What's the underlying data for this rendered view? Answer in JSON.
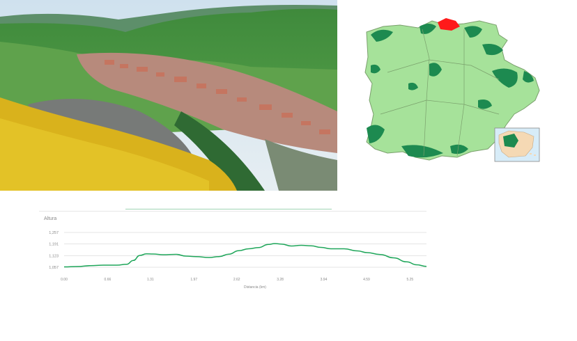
{
  "photo": {
    "subject": "aerial-view-village-valley"
  },
  "region_map": {
    "region_fill": "#a6e29a",
    "forest_fill": "#1d8a50",
    "highlight_fill": "#ff1a1a"
  },
  "chart_data": {
    "type": "area",
    "title": "Altura",
    "xlabel": "Distancia (km)",
    "ylabel": "",
    "x_ticks": [
      "0.00",
      "0.66",
      "1.31",
      "1.97",
      "2.62",
      "3.28",
      "3.94",
      "4.59",
      "5.25"
    ],
    "y_ticks": [
      "1,057",
      "1,123",
      "1,191",
      "1,257"
    ],
    "xlim": [
      0,
      5.5
    ],
    "ylim": [
      1057,
      1257
    ],
    "line_color": "#1fa65a",
    "grid": true,
    "series": [
      {
        "x": [
          0.0,
          0.2,
          0.4,
          0.6,
          0.8,
          0.95,
          1.05,
          1.15,
          1.25,
          1.35,
          1.5,
          1.7,
          1.85,
          2.0,
          2.2,
          2.35,
          2.5,
          2.65,
          2.8,
          2.95,
          3.1,
          3.2,
          3.3,
          3.45,
          3.6,
          3.75,
          3.9,
          4.05,
          4.25,
          4.45,
          4.6,
          4.8,
          5.0,
          5.2,
          5.35,
          5.5
        ],
        "y": [
          1059,
          1061,
          1066,
          1069,
          1069,
          1074,
          1096,
          1125,
          1134,
          1133,
          1129,
          1131,
          1121,
          1118,
          1113,
          1118,
          1132,
          1152,
          1163,
          1170,
          1188,
          1193,
          1190,
          1179,
          1183,
          1180,
          1171,
          1163,
          1163,
          1151,
          1141,
          1130,
          1111,
          1088,
          1071,
          1062
        ]
      }
    ]
  }
}
